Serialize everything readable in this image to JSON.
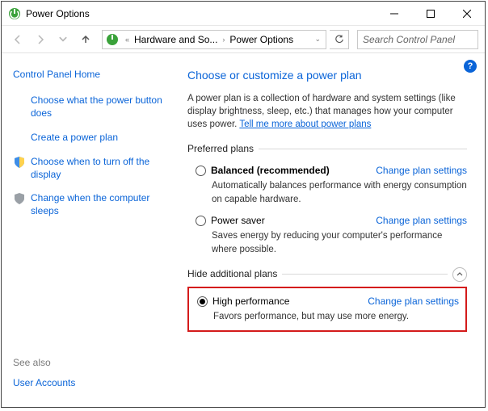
{
  "window": {
    "title": "Power Options"
  },
  "breadcrumb": {
    "segments": [
      "Hardware and So...",
      "Power Options"
    ]
  },
  "search": {
    "placeholder": "Search Control Panel"
  },
  "help": {
    "symbol": "?"
  },
  "sidebar": {
    "cp_home": "Control Panel Home",
    "items": [
      {
        "label": "Choose what the power button does"
      },
      {
        "label": "Create a power plan"
      },
      {
        "label": "Choose when to turn off the display"
      },
      {
        "label": "Change when the computer sleeps"
      }
    ],
    "see_also": "See also",
    "user_accounts": "User Accounts"
  },
  "main": {
    "heading": "Choose or customize a power plan",
    "desc_1": "A power plan is a collection of hardware and system settings (like display brightness, sleep, etc.) that manages how your computer uses power. ",
    "desc_link": "Tell me more about power plans",
    "preferred_label": "Preferred plans",
    "hide_label": "Hide additional plans",
    "plans": {
      "balanced": {
        "name": "Balanced (recommended)",
        "chg": "Change plan settings",
        "desc": "Automatically balances performance with energy consumption on capable hardware."
      },
      "saver": {
        "name": "Power saver",
        "chg": "Change plan settings",
        "desc": "Saves energy by reducing your computer's performance where possible."
      },
      "high": {
        "name": "High performance",
        "chg": "Change plan settings",
        "desc": "Favors performance, but may use more energy."
      }
    }
  }
}
